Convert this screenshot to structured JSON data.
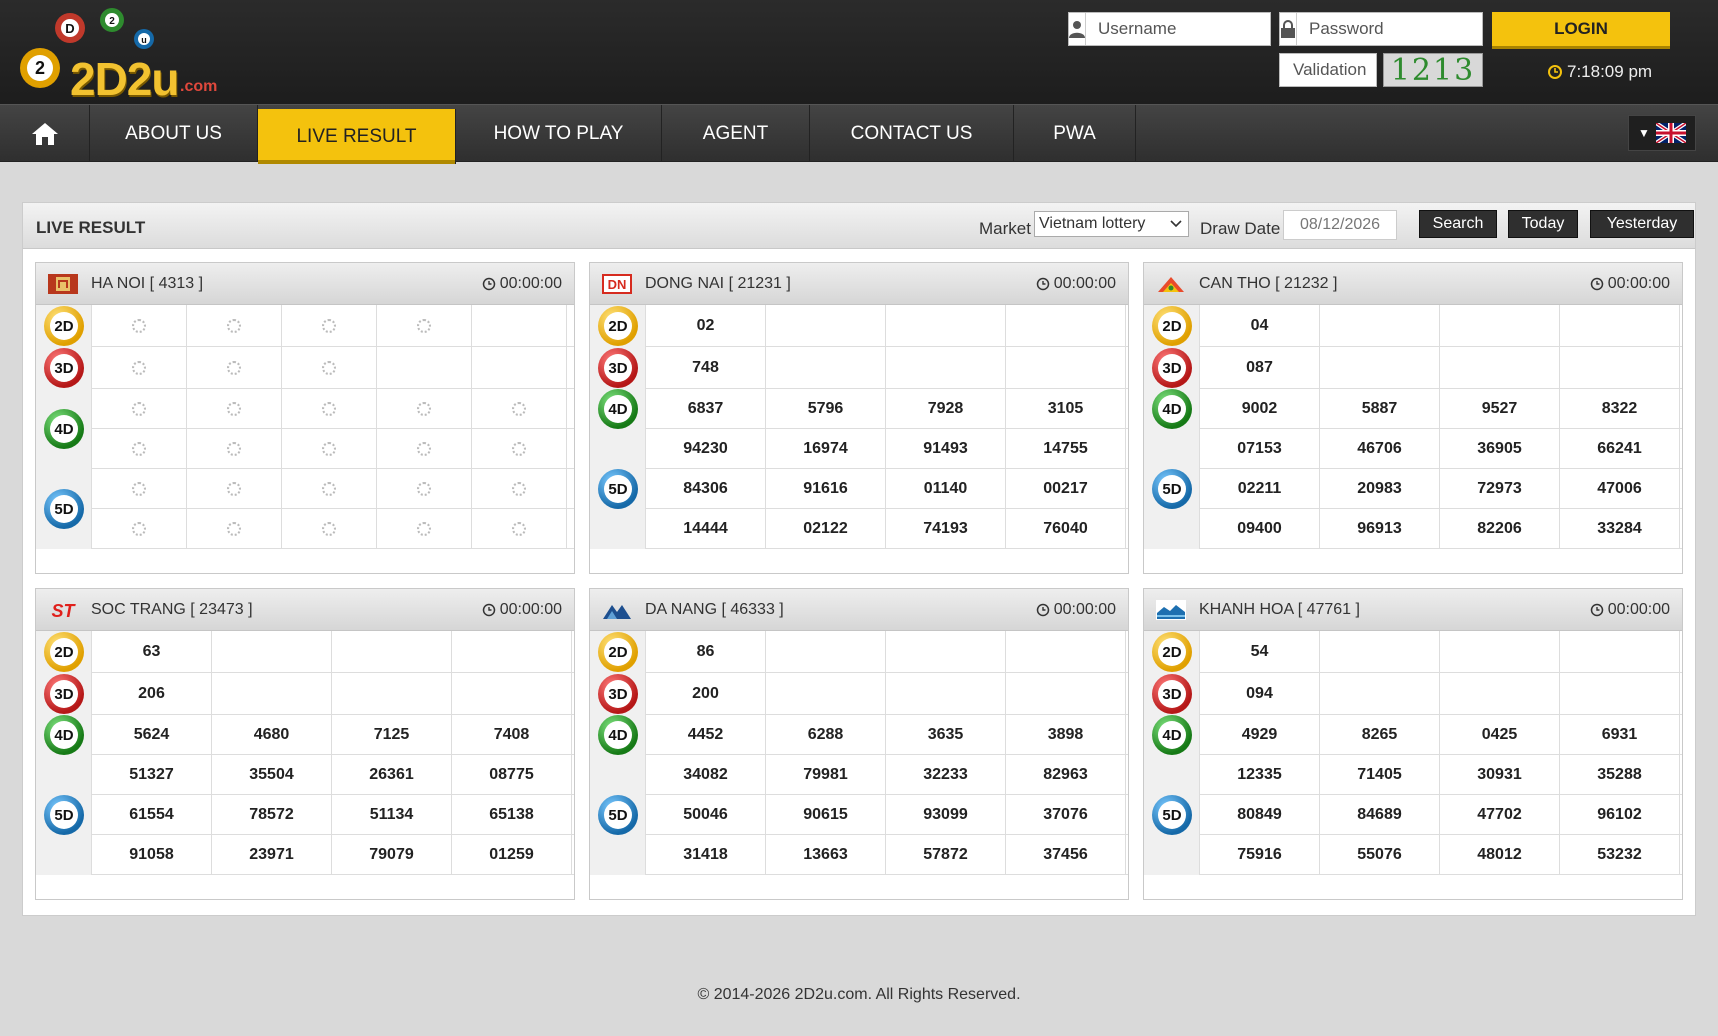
{
  "header": {
    "logo_text": "2D2u",
    "logo_suffix": ".com",
    "logo_balls": [
      "D",
      "2",
      "u",
      "2"
    ],
    "username_placeholder": "Username",
    "password_placeholder": "Password",
    "validation_placeholder": "Validation",
    "captcha": "1213",
    "login_label": "LOGIN",
    "clock": "7:18:09 pm"
  },
  "nav": {
    "items": [
      "ABOUT US",
      "LIVE RESULT",
      "HOW TO PLAY",
      "AGENT",
      "CONTACT US",
      "PWA"
    ],
    "active": "LIVE RESULT"
  },
  "panel": {
    "title": "LIVE RESULT",
    "market_label": "Market",
    "market_value": "Vietnam lottery",
    "draw_date_label": "Draw Date",
    "draw_date_value": "08/12/2026",
    "buttons": [
      "Search",
      "Today",
      "Yesterday"
    ]
  },
  "tags": [
    "2D",
    "3D",
    "4D",
    "5D"
  ],
  "markets": [
    {
      "name": "HA NOI [ 4313 ]",
      "time": "00:00:00",
      "loading": true,
      "d2": [],
      "d3": [],
      "d4": [],
      "d5": []
    },
    {
      "name": "DONG NAI [ 21231 ]",
      "time": "00:00:00",
      "loading": false,
      "d2": [
        "02"
      ],
      "d3": [
        "748"
      ],
      "d4": [
        "6837",
        "5796",
        "7928",
        "3105"
      ],
      "d5": [
        "94230",
        "16974",
        "91493",
        "14755",
        "84306",
        "91616",
        "01140",
        "00217",
        "14444",
        "02122",
        "74193",
        "76040"
      ]
    },
    {
      "name": "CAN THO [ 21232 ]",
      "time": "00:00:00",
      "loading": false,
      "d2": [
        "04"
      ],
      "d3": [
        "087"
      ],
      "d4": [
        "9002",
        "5887",
        "9527",
        "8322"
      ],
      "d5": [
        "07153",
        "46706",
        "36905",
        "66241",
        "02211",
        "20983",
        "72973",
        "47006",
        "09400",
        "96913",
        "82206",
        "33284"
      ]
    },
    {
      "name": "SOC TRANG [ 23473 ]",
      "time": "00:00:00",
      "loading": false,
      "d2": [
        "63"
      ],
      "d3": [
        "206"
      ],
      "d4": [
        "5624",
        "4680",
        "7125",
        "7408"
      ],
      "d5": [
        "51327",
        "35504",
        "26361",
        "08775",
        "61554",
        "78572",
        "51134",
        "65138",
        "91058",
        "23971",
        "79079",
        "01259"
      ]
    },
    {
      "name": "DA NANG [ 46333 ]",
      "time": "00:00:00",
      "loading": false,
      "d2": [
        "86"
      ],
      "d3": [
        "200"
      ],
      "d4": [
        "4452",
        "6288",
        "3635",
        "3898"
      ],
      "d5": [
        "34082",
        "79981",
        "32233",
        "82963",
        "50046",
        "90615",
        "93099",
        "37076",
        "31418",
        "13663",
        "57872",
        "37456"
      ]
    },
    {
      "name": "KHANH HOA [ 47761 ]",
      "time": "00:00:00",
      "loading": false,
      "d2": [
        "54"
      ],
      "d3": [
        "094"
      ],
      "d4": [
        "4929",
        "8265",
        "0425",
        "6931"
      ],
      "d5": [
        "12335",
        "71405",
        "30931",
        "35288",
        "80849",
        "84689",
        "47702",
        "96102",
        "75916",
        "55076",
        "48012",
        "53232"
      ]
    }
  ],
  "footer": "© 2014-2026 2D2u.com. All Rights Reserved."
}
